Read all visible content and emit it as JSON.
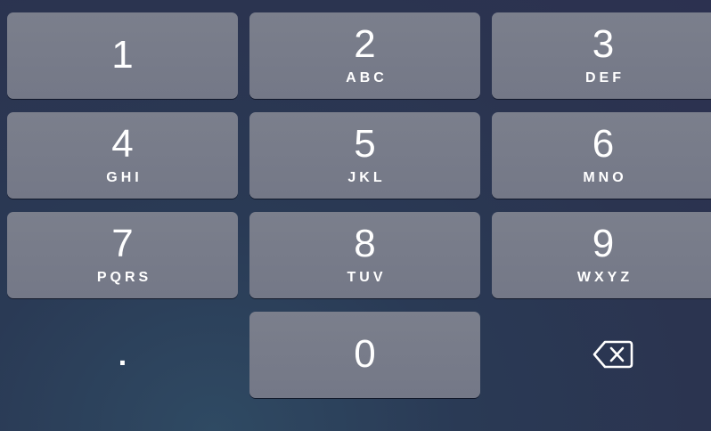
{
  "keypad": {
    "keys": [
      {
        "digit": "1",
        "letters": ""
      },
      {
        "digit": "2",
        "letters": "ABC"
      },
      {
        "digit": "3",
        "letters": "DEF"
      },
      {
        "digit": "4",
        "letters": "GHI"
      },
      {
        "digit": "5",
        "letters": "JKL"
      },
      {
        "digit": "6",
        "letters": "MNO"
      },
      {
        "digit": "7",
        "letters": "PQRS"
      },
      {
        "digit": "8",
        "letters": "TUV"
      },
      {
        "digit": "9",
        "letters": "WXYZ"
      },
      {
        "digit": "0",
        "letters": ""
      }
    ],
    "decimal_label": ".",
    "delete_icon": "backspace-icon"
  },
  "colors": {
    "key_background": "#777b89",
    "text": "#ffffff",
    "background": "#2b3450"
  }
}
